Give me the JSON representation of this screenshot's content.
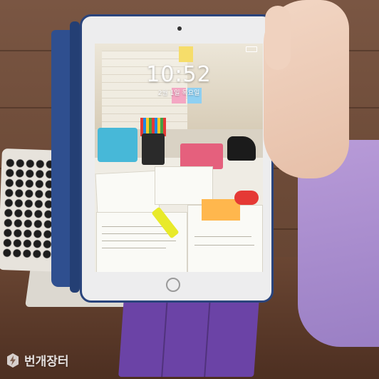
{
  "lock_screen": {
    "time": "10:52",
    "date": "2월 1일 목요일"
  },
  "watermark": {
    "icon": "bolt-icon",
    "text": "번개장터"
  },
  "colors": {
    "case_blue": "#2a447c",
    "case_purple": "#6b43a6",
    "sleeve_lavender": "#b89bd8"
  }
}
